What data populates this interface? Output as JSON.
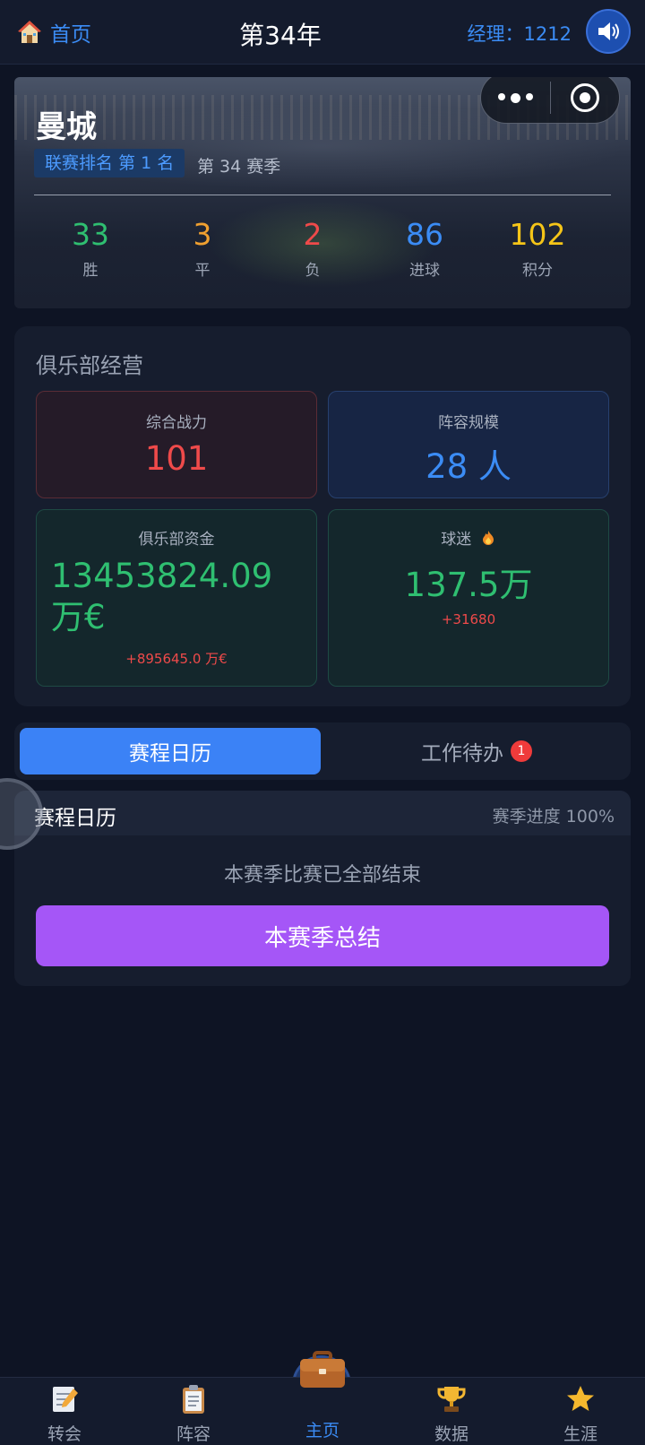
{
  "topbar": {
    "home_label": "首页",
    "title": "第34年",
    "manager_label": "经理：1212"
  },
  "hero": {
    "team_name": "曼城",
    "rank_label": "联赛排名 第 1 名",
    "season_label": "第 34 赛季",
    "stats": [
      {
        "value": "33",
        "label": "胜",
        "color": "#2fbf71"
      },
      {
        "value": "3",
        "label": "平",
        "color": "#f0a030"
      },
      {
        "value": "2",
        "label": "负",
        "color": "#ef4a4a"
      },
      {
        "value": "86",
        "label": "进球",
        "color": "#3b8cf5"
      },
      {
        "value": "102",
        "label": "积分",
        "color": "#f5c518"
      }
    ]
  },
  "management": {
    "title": "俱乐部经营",
    "power": {
      "label": "综合战力",
      "value": "101"
    },
    "squad": {
      "label": "阵容规模",
      "value": "28 人"
    },
    "funds": {
      "label": "俱乐部资金",
      "value_line1": "13453824.09",
      "value_line2": "万€",
      "change": "+895645.0 万€"
    },
    "fans": {
      "label": "球迷",
      "value": "137.5万",
      "change": "+31680"
    }
  },
  "tabs": {
    "schedule": "赛程日历",
    "todo": "工作待办",
    "todo_badge": "1"
  },
  "schedule": {
    "title": "赛程日历",
    "progress": "赛季进度 100%",
    "message": "本赛季比赛已全部结束",
    "summary_button": "本赛季总结"
  },
  "nav": {
    "items": [
      {
        "label": "转会",
        "icon": "memo-icon"
      },
      {
        "label": "阵容",
        "icon": "clipboard-icon"
      },
      {
        "label": "主页",
        "icon": "briefcase-icon"
      },
      {
        "label": "数据",
        "icon": "trophy-icon"
      },
      {
        "label": "生涯",
        "icon": "star-icon"
      }
    ]
  },
  "colors": {
    "accent": "#3b82f6",
    "summary": "#a556f7",
    "red": "#ef4a4a",
    "green": "#2fbf71",
    "background": "#0e1424"
  }
}
